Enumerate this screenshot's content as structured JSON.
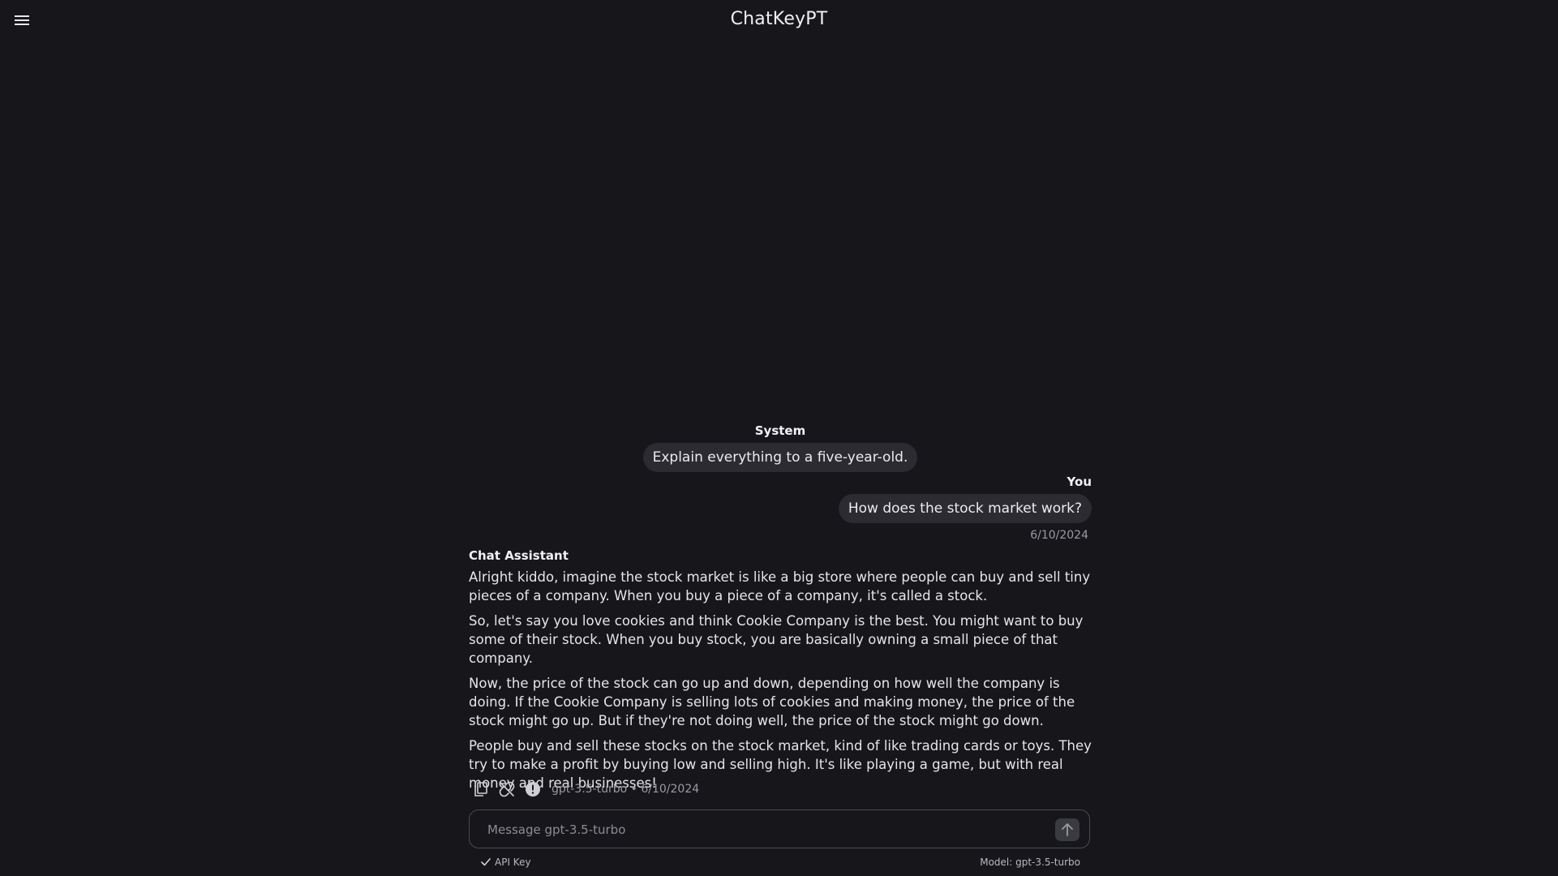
{
  "header": {
    "title": "ChatKeyPT",
    "menu_icon": "hamburger-menu-icon"
  },
  "conversation": {
    "system": {
      "label": "System",
      "text": "Explain everything to a five-year-old."
    },
    "user": {
      "label": "You",
      "text": "How does the stock market work?",
      "date": "6/10/2024"
    },
    "assistant": {
      "label": "Chat Assistant",
      "paragraphs": [
        "Alright kiddo, imagine the stock market is like a big store where people can buy and sell tiny pieces of a company. When you buy a piece of a company, it's called a stock.",
        "So, let's say you love cookies and think Cookie Company is the best. You might want to buy some of their stock. When you buy stock, you are basically owning a small piece of that company.",
        "Now, the price of the stock can go up and down, depending on how well the company is doing. If the Cookie Company is selling lots of cookies and making money, the price of the stock might go up. But if they're not doing well, the price of the stock might go down.",
        "People buy and sell these stocks on the stock market, kind of like trading cards or toys. They try to make a profit by buying low and selling high. It's like playing a game, but with real money and real businesses!"
      ],
      "meta": "gpt-3.5-turbo • 6/10/2024",
      "actions": [
        "copy-icon",
        "unlink-icon",
        "alert-icon"
      ]
    }
  },
  "composer": {
    "placeholder": "Message gpt-3.5-turbo",
    "value": "",
    "send_icon": "arrow-up-icon"
  },
  "footer": {
    "api_key_label": "API Key",
    "api_key_icon": "check-icon",
    "model_label": "Model: gpt-3.5-turbo"
  }
}
